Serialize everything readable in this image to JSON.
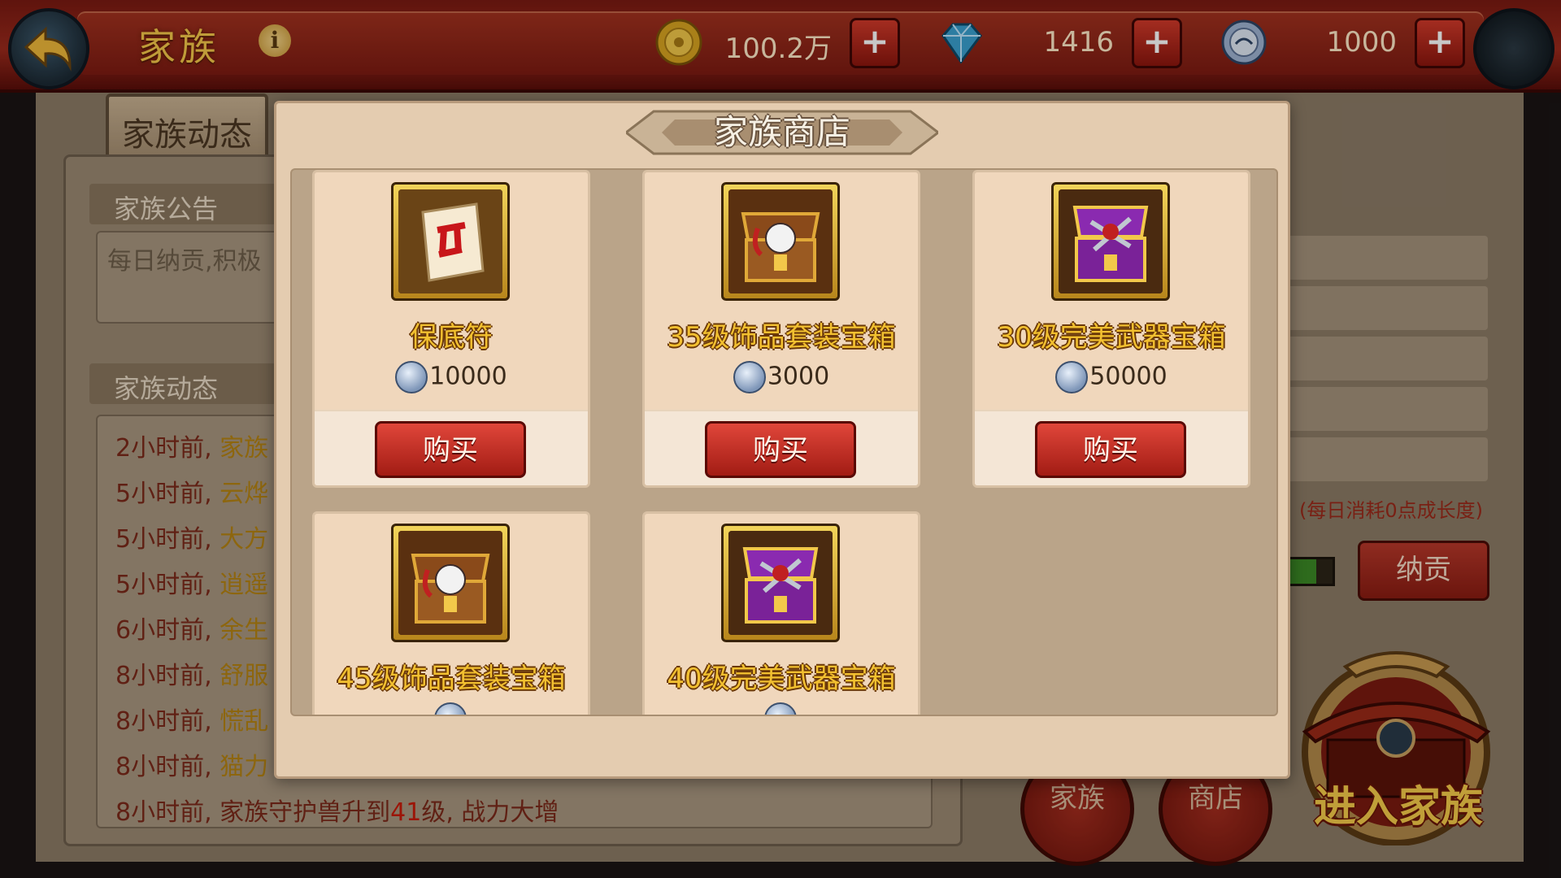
{
  "header": {
    "title": "家族",
    "resources": [
      {
        "name": "gold",
        "icon": "gold-coin-icon",
        "value": "100.2万"
      },
      {
        "name": "diamond",
        "icon": "diamond-icon",
        "value": "1416"
      },
      {
        "name": "family-coin",
        "icon": "family-coin-icon",
        "value": "1000"
      }
    ]
  },
  "background": {
    "tab_label": "家族动态",
    "notice_title": "家族公告",
    "notice_text": "每日纳贡,积极",
    "feed_title": "家族动态",
    "feed": [
      {
        "time": "2小时前,",
        "text": "家族"
      },
      {
        "time": "5小时前,",
        "text": "云烨"
      },
      {
        "time": "5小时前,",
        "text": "大方"
      },
      {
        "time": "5小时前,",
        "text": "逍遥"
      },
      {
        "time": "6小时前,",
        "text": "余生"
      },
      {
        "time": "8小时前,",
        "text": "舒服"
      },
      {
        "time": "8小时前,",
        "text": "慌乱"
      },
      {
        "time": "8小时前,",
        "text": "猫力"
      }
    ],
    "last_feed": {
      "time": "8小时前,",
      "before": "家族守护兽升到",
      "level": "41",
      "after": "级, 战力大增"
    },
    "consume_hint": "(每日消耗0点成长度)",
    "growth_progress": 0.7,
    "tribute_label": "纳贡",
    "family_button": "家族",
    "shop_button": "商店",
    "enter_label": "进入家族"
  },
  "shop": {
    "title": "家族商店",
    "buy_label": "购买",
    "currency_icon": "family-coin-icon",
    "items": [
      {
        "name": "保底符",
        "price": "10000",
        "icon": "talisman-icon"
      },
      {
        "name": "35级饰品套装宝箱",
        "price": "3000",
        "icon": "accessory-chest-icon"
      },
      {
        "name": "30级完美武器宝箱",
        "price": "50000",
        "icon": "weapon-chest-icon"
      },
      {
        "name": "45级饰品套装宝箱",
        "price": "",
        "icon": "accessory-chest-icon"
      },
      {
        "name": "40级完美武器宝箱",
        "price": "",
        "icon": "weapon-chest-icon"
      }
    ]
  },
  "colors": {
    "gold_text": "#f2c030",
    "button_red": "#c0342a",
    "modal_bg": "#e4ccb0"
  }
}
